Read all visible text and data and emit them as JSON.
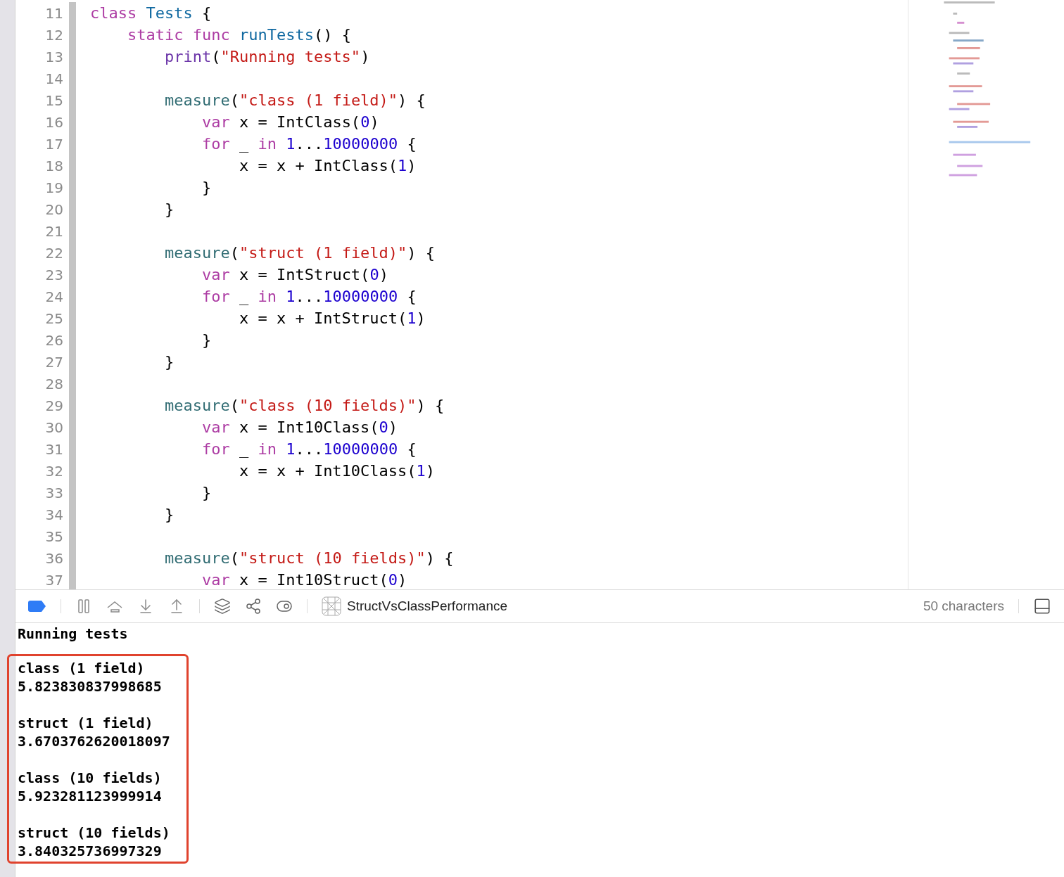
{
  "editor": {
    "lines": [
      {
        "number": "11",
        "tokens": [
          {
            "kind": "keyword",
            "text": "class"
          },
          {
            "kind": "type",
            "text": " Tests"
          },
          {
            "kind": "plain",
            "text": " {"
          }
        ]
      },
      {
        "number": "12",
        "tokens": [
          {
            "kind": "keyword",
            "text": "    static func"
          },
          {
            "kind": "type",
            "text": " runTests"
          },
          {
            "kind": "plain",
            "text": "() {"
          }
        ]
      },
      {
        "number": "13",
        "tokens": [
          {
            "kind": "builtin",
            "text": "        print"
          },
          {
            "kind": "plain",
            "text": "("
          },
          {
            "kind": "string",
            "text": "\"Running tests\""
          },
          {
            "kind": "plain",
            "text": ")"
          }
        ]
      },
      {
        "number": "14"
      },
      {
        "number": "15",
        "tokens": [
          {
            "kind": "call",
            "text": "        measure"
          },
          {
            "kind": "plain",
            "text": "("
          },
          {
            "kind": "string",
            "text": "\"class (1 field)\""
          },
          {
            "kind": "plain",
            "text": ") {"
          }
        ]
      },
      {
        "number": "16",
        "tokens": [
          {
            "kind": "keyword",
            "text": "            var"
          },
          {
            "kind": "plain",
            "text": " x = IntClass("
          },
          {
            "kind": "number",
            "text": "0"
          },
          {
            "kind": "plain",
            "text": ")"
          }
        ]
      },
      {
        "number": "17",
        "tokens": [
          {
            "kind": "keyword",
            "text": "            for"
          },
          {
            "kind": "plain",
            "text": " _ "
          },
          {
            "kind": "keyword",
            "text": "in"
          },
          {
            "kind": "number",
            "text": " 1"
          },
          {
            "kind": "plain",
            "text": "..."
          },
          {
            "kind": "number",
            "text": "10000000"
          },
          {
            "kind": "plain",
            "text": " {"
          }
        ]
      },
      {
        "number": "18",
        "tokens": [
          {
            "kind": "plain",
            "text": "                x = x + IntClass("
          },
          {
            "kind": "number",
            "text": "1"
          },
          {
            "kind": "plain",
            "text": ")"
          }
        ]
      },
      {
        "number": "19",
        "tokens": [
          {
            "kind": "plain",
            "text": "            }"
          }
        ]
      },
      {
        "number": "20",
        "tokens": [
          {
            "kind": "plain",
            "text": "        }"
          }
        ]
      },
      {
        "number": "21"
      },
      {
        "number": "22",
        "tokens": [
          {
            "kind": "call",
            "text": "        measure"
          },
          {
            "kind": "plain",
            "text": "("
          },
          {
            "kind": "string",
            "text": "\"struct (1 field)\""
          },
          {
            "kind": "plain",
            "text": ") {"
          }
        ]
      },
      {
        "number": "23",
        "tokens": [
          {
            "kind": "keyword",
            "text": "            var"
          },
          {
            "kind": "plain",
            "text": " x = IntStruct("
          },
          {
            "kind": "number",
            "text": "0"
          },
          {
            "kind": "plain",
            "text": ")"
          }
        ]
      },
      {
        "number": "24",
        "tokens": [
          {
            "kind": "keyword",
            "text": "            for"
          },
          {
            "kind": "plain",
            "text": " _ "
          },
          {
            "kind": "keyword",
            "text": "in"
          },
          {
            "kind": "number",
            "text": " 1"
          },
          {
            "kind": "plain",
            "text": "..."
          },
          {
            "kind": "number",
            "text": "10000000"
          },
          {
            "kind": "plain",
            "text": " {"
          }
        ]
      },
      {
        "number": "25",
        "tokens": [
          {
            "kind": "plain",
            "text": "                x = x + IntStruct("
          },
          {
            "kind": "number",
            "text": "1"
          },
          {
            "kind": "plain",
            "text": ")"
          }
        ]
      },
      {
        "number": "26",
        "tokens": [
          {
            "kind": "plain",
            "text": "            }"
          }
        ]
      },
      {
        "number": "27",
        "tokens": [
          {
            "kind": "plain",
            "text": "        }"
          }
        ]
      },
      {
        "number": "28"
      },
      {
        "number": "29",
        "tokens": [
          {
            "kind": "call",
            "text": "        measure"
          },
          {
            "kind": "plain",
            "text": "("
          },
          {
            "kind": "string",
            "text": "\"class (10 fields)\""
          },
          {
            "kind": "plain",
            "text": ") {"
          }
        ]
      },
      {
        "number": "30",
        "tokens": [
          {
            "kind": "keyword",
            "text": "            var"
          },
          {
            "kind": "plain",
            "text": " x = Int10Class("
          },
          {
            "kind": "number",
            "text": "0"
          },
          {
            "kind": "plain",
            "text": ")"
          }
        ]
      },
      {
        "number": "31",
        "tokens": [
          {
            "kind": "keyword",
            "text": "            for"
          },
          {
            "kind": "plain",
            "text": " _ "
          },
          {
            "kind": "keyword",
            "text": "in"
          },
          {
            "kind": "number",
            "text": " 1"
          },
          {
            "kind": "plain",
            "text": "..."
          },
          {
            "kind": "number",
            "text": "10000000"
          },
          {
            "kind": "plain",
            "text": " {"
          }
        ]
      },
      {
        "number": "32",
        "tokens": [
          {
            "kind": "plain",
            "text": "                x = x + Int10Class("
          },
          {
            "kind": "number",
            "text": "1"
          },
          {
            "kind": "plain",
            "text": ")"
          }
        ]
      },
      {
        "number": "33",
        "tokens": [
          {
            "kind": "plain",
            "text": "            }"
          }
        ]
      },
      {
        "number": "34",
        "tokens": [
          {
            "kind": "plain",
            "text": "        }"
          }
        ]
      },
      {
        "number": "35"
      },
      {
        "number": "36",
        "tokens": [
          {
            "kind": "call",
            "text": "        measure"
          },
          {
            "kind": "plain",
            "text": "("
          },
          {
            "kind": "string",
            "text": "\"struct (10 fields)\""
          },
          {
            "kind": "plain",
            "text": ") {"
          }
        ]
      },
      {
        "number": "37",
        "tokens": [
          {
            "kind": "keyword",
            "text": "            var"
          },
          {
            "kind": "plain",
            "text": " x = Int10Struct("
          },
          {
            "kind": "number",
            "text": "0"
          },
          {
            "kind": "plain",
            "text": ")"
          }
        ]
      }
    ]
  },
  "debug_bar": {
    "scheme": "StructVsClassPerformance",
    "status": "50 characters"
  },
  "console": {
    "header": "Running tests",
    "results": [
      {
        "label": "class (1 field)",
        "value": "5.823830837998685"
      },
      {
        "label": "struct (1 field)",
        "value": "3.6703762620018097"
      },
      {
        "label": "class (10 fields)",
        "value": "5.923281123999914"
      },
      {
        "label": "struct (10 fields)",
        "value": "3.840325736997329"
      }
    ]
  }
}
